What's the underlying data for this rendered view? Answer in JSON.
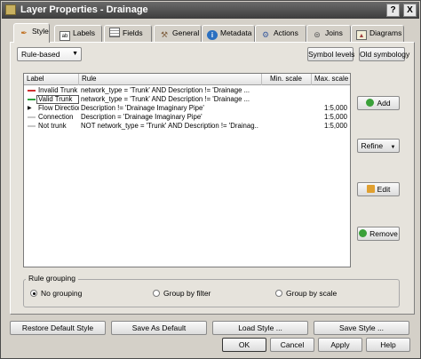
{
  "window": {
    "title": "Layer Properties - Drainage",
    "help_glyph": "?",
    "close_glyph": "X"
  },
  "tabs": [
    {
      "label": "Style",
      "icon": "brush-icon"
    },
    {
      "label": "Labels",
      "icon": "labels-icon"
    },
    {
      "label": "Fields",
      "icon": "table-icon"
    },
    {
      "label": "General",
      "icon": "tools-icon"
    },
    {
      "label": "Metadata",
      "icon": "info-icon"
    },
    {
      "label": "Actions",
      "icon": "gear-icon"
    },
    {
      "label": "Joins",
      "icon": "joins-icon"
    },
    {
      "label": "Diagrams",
      "icon": "diagram-icon"
    }
  ],
  "renderer": {
    "selected": "Rule-based",
    "symbol_levels_label": "Symbol levels",
    "old_symbology_label": "Old symbology"
  },
  "rules_table": {
    "columns": [
      "Label",
      "Rule",
      "Min. scale",
      "Max. scale"
    ],
    "rows": [
      {
        "label": "Invalid Trunk",
        "rule": "network_type = 'Trunk' AND Description != 'Drainage ...",
        "min_scale": "",
        "max_scale": "",
        "color": "#d03030"
      },
      {
        "label": "Valid Trunk",
        "rule": "network_type = 'Trunk' AND Description != 'Drainage ...",
        "min_scale": "",
        "max_scale": "",
        "color": "#30a040"
      },
      {
        "label": "Flow Direction",
        "rule": "Description != 'Drainage Imaginary Pipe'",
        "min_scale": "",
        "max_scale": "1:5,000",
        "color": ""
      },
      {
        "label": "Connection",
        "rule": "Description = 'Drainage Imaginary Pipe'",
        "min_scale": "",
        "max_scale": "1:5,000",
        "color": "#c8c8c8"
      },
      {
        "label": "Not trunk",
        "rule": "NOT network_type = 'Trunk' AND Description != 'Drainag...",
        "min_scale": "",
        "max_scale": "1:5,000",
        "color": "#c8c8c8"
      }
    ]
  },
  "side_buttons": {
    "add": "Add",
    "refine": "Refine",
    "edit": "Edit",
    "remove": "Remove"
  },
  "rule_grouping": {
    "title": "Rule grouping",
    "options": [
      "No grouping",
      "Group by filter",
      "Group by scale"
    ],
    "selected": "No grouping"
  },
  "bottom_bar": {
    "restore_default": "Restore Default Style",
    "save_as_default": "Save As Default",
    "load_style": "Load Style ...",
    "save_style": "Save Style ...",
    "ok": "OK",
    "cancel": "Cancel",
    "apply": "Apply",
    "help": "Help"
  },
  "colors": {
    "title_bar": "#3d3d3d",
    "invalid_trunk": "#d03030",
    "valid_trunk": "#30a040",
    "add_icon": "#3aa03a",
    "remove_icon": "#3aa03a"
  }
}
